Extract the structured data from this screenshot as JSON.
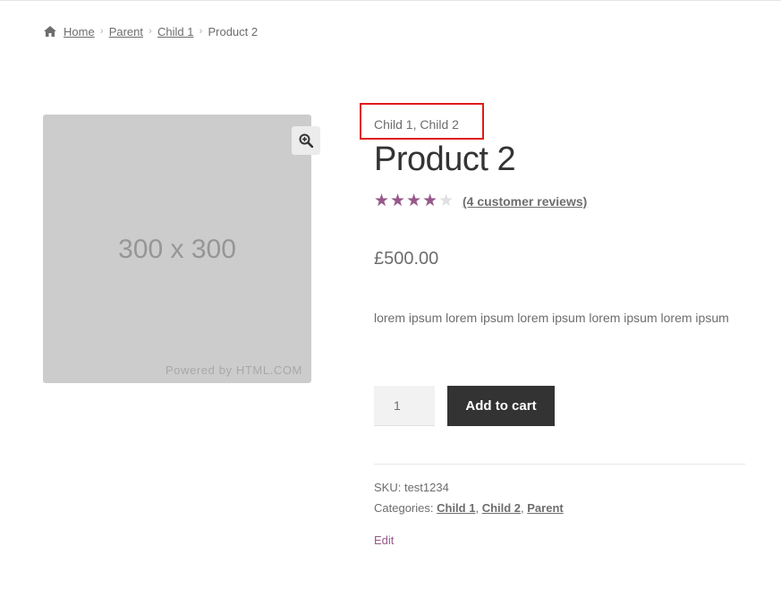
{
  "breadcrumb": {
    "home": "Home",
    "items": [
      "Parent",
      "Child 1"
    ],
    "current": "Product 2",
    "separator": "›"
  },
  "image": {
    "placeholder_text": "300 x 300",
    "powered_by": "Powered by HTML.COM"
  },
  "product": {
    "categories_line": "Child 1, Child 2",
    "title": "Product 2",
    "rating": 3.75,
    "rating_max": 5,
    "stars_glyph": "★★★★★",
    "reviews_link": "(4 customer reviews)",
    "price": "£500.00",
    "description": "lorem ipsum lorem ipsum lorem ipsum lorem ipsum lorem ipsum"
  },
  "cart": {
    "quantity": "1",
    "add_button": "Add to cart"
  },
  "meta": {
    "sku_label": "SKU:",
    "sku_value": "test1234",
    "categories_label": "Categories:",
    "categories": [
      "Child 1",
      "Child 2",
      "Parent"
    ],
    "edit": "Edit"
  },
  "colors": {
    "accent": "#96588a",
    "highlight_box": "#e01b1b",
    "button_bg": "#333333"
  }
}
